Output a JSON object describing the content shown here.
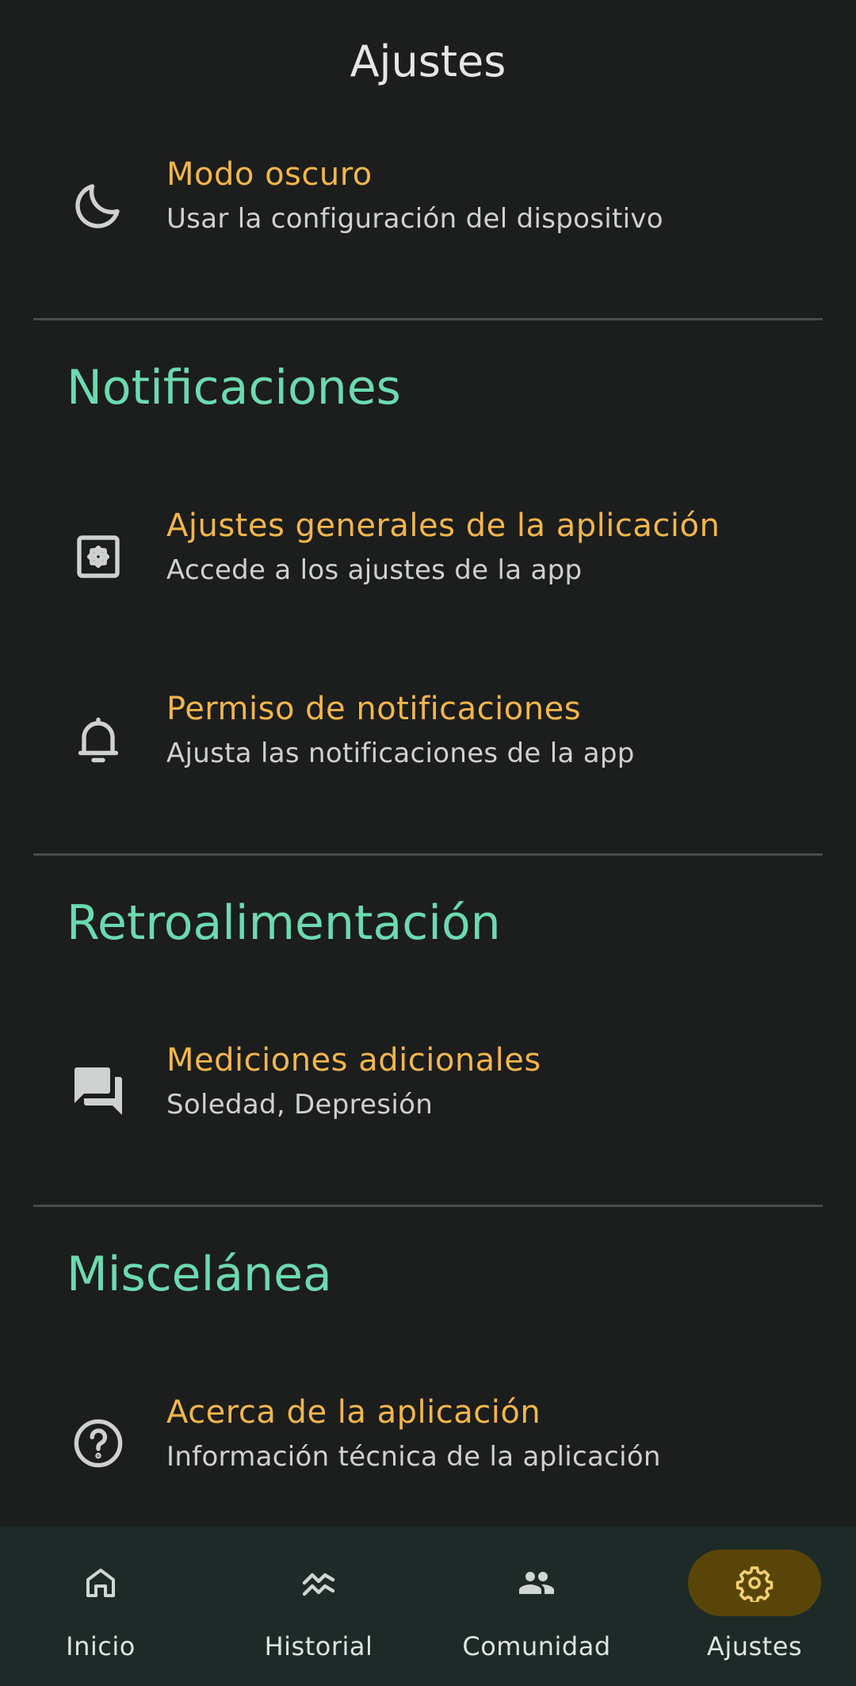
{
  "header": {
    "title": "Ajustes"
  },
  "appearance": {
    "dark_mode": {
      "icon": "moon-icon",
      "title": "Modo oscuro",
      "subtitle": "Usar la configuración del dispositivo"
    }
  },
  "sections": {
    "notifications": {
      "header": "Notificaciones",
      "items": [
        {
          "icon": "settings-app-icon",
          "title": "Ajustes generales de la aplicación",
          "subtitle": "Accede a los ajustes de la app"
        },
        {
          "icon": "bell-icon",
          "title": "Permiso de notificaciones",
          "subtitle": "Ajusta las notificaciones de la app"
        }
      ]
    },
    "feedback": {
      "header": "Retroalimentación",
      "items": [
        {
          "icon": "chat-bubbles-icon",
          "title": "Mediciones adicionales",
          "subtitle": "Soledad, Depresión"
        }
      ]
    },
    "misc": {
      "header": "Miscelánea",
      "items": [
        {
          "icon": "help-circle-icon",
          "title": "Acerca de la aplicación",
          "subtitle": "Información técnica de la aplicación"
        }
      ]
    }
  },
  "bottom_nav": {
    "items": [
      {
        "label": "Inicio",
        "icon": "home-icon",
        "active": false
      },
      {
        "label": "Historial",
        "icon": "history-chart-icon",
        "active": false
      },
      {
        "label": "Comunidad",
        "icon": "people-icon",
        "active": false
      },
      {
        "label": "Ajustes",
        "icon": "gear-icon",
        "active": true
      }
    ]
  },
  "colors": {
    "background": "#1c1d1d",
    "item_title": "#f2b64a",
    "item_subtitle": "#cfd0d0",
    "section_header": "#6cdab0",
    "divider": "#4a4b4b",
    "nav_background": "#1e2a28",
    "nav_active_pill": "#5a4509",
    "nav_active_icon": "#f2cf72"
  }
}
